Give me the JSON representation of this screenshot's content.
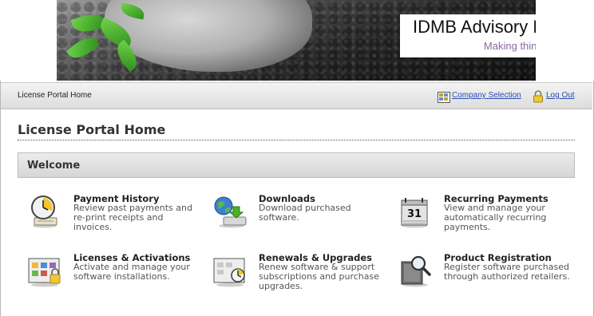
{
  "banner": {
    "company": "IDMB Advisory Ltd",
    "tagline": "Making things better"
  },
  "toolbar": {
    "breadcrumb": "License Portal Home",
    "company_selection": "Company Selection",
    "log_out": "Log Out"
  },
  "page": {
    "title": "License Portal Home",
    "section": "Welcome"
  },
  "items": [
    {
      "title": "Payment History",
      "desc": "Review past payments and re-print receipts and invoices.",
      "icon": "clock-receipt-icon"
    },
    {
      "title": "Downloads",
      "desc": "Download purchased software.",
      "icon": "globe-download-icon"
    },
    {
      "title": "Recurring Payments",
      "desc": "View and manage your automatically recurring payments.",
      "icon": "calendar-icon"
    },
    {
      "title": "Licenses & Activations",
      "desc": "Activate and manage your software installations.",
      "icon": "license-lock-icon"
    },
    {
      "title": "Renewals & Upgrades",
      "desc": "Renew software & support subscriptions and purchase upgrades.",
      "icon": "renewal-clock-icon"
    },
    {
      "title": "Product Registration",
      "desc": "Register software purchased through authorized retailers.",
      "icon": "magnifier-register-icon"
    }
  ],
  "calendar_day": "31",
  "colors": {
    "link": "#2a4fb0",
    "accent_green": "#4caf2a",
    "tagline": "#8a6aa0"
  }
}
